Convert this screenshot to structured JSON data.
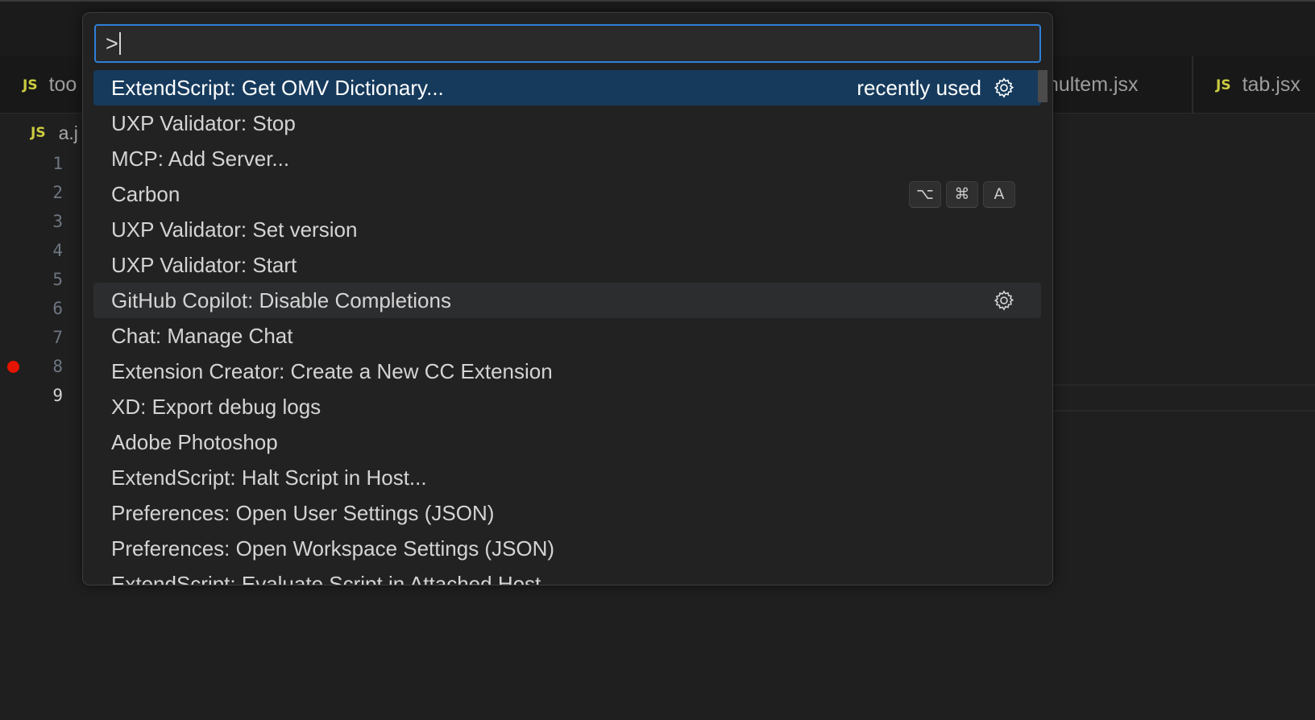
{
  "tabs": [
    {
      "icon": "JS",
      "label": "too"
    },
    {
      "icon": "",
      "label": "nultem.jsx"
    },
    {
      "icon": "JS",
      "label": "tab.jsx"
    }
  ],
  "breadcrumb": {
    "icon": "JS",
    "label": "a.j"
  },
  "gutter": [
    "1",
    "2",
    "3",
    "4",
    "5",
    "6",
    "7",
    "8",
    "9"
  ],
  "palette": {
    "input_value": ">",
    "items": [
      {
        "label": "ExtendScript: Get OMV Dictionary...",
        "detail": "recently used",
        "icon": "gear-icon",
        "keys": []
      },
      {
        "label": "UXP Validator: Stop",
        "detail": "",
        "icon": "",
        "keys": []
      },
      {
        "label": "MCP: Add Server...",
        "detail": "",
        "icon": "",
        "keys": []
      },
      {
        "label": "Carbon",
        "detail": "",
        "icon": "",
        "keys": [
          "⌥",
          "⌘",
          "A"
        ]
      },
      {
        "label": "UXP Validator: Set version",
        "detail": "",
        "icon": "",
        "keys": []
      },
      {
        "label": "UXP Validator: Start",
        "detail": "",
        "icon": "",
        "keys": []
      },
      {
        "label": "GitHub Copilot: Disable Completions",
        "detail": "",
        "icon": "gear-icon",
        "keys": []
      },
      {
        "label": "Chat: Manage Chat",
        "detail": "",
        "icon": "",
        "keys": []
      },
      {
        "label": "Extension Creator: Create a New CC Extension",
        "detail": "",
        "icon": "",
        "keys": []
      },
      {
        "label": "XD: Export debug logs",
        "detail": "",
        "icon": "",
        "keys": []
      },
      {
        "label": "Adobe Photoshop",
        "detail": "",
        "icon": "",
        "keys": []
      },
      {
        "label": "ExtendScript: Halt Script in Host...",
        "detail": "",
        "icon": "",
        "keys": []
      },
      {
        "label": "Preferences: Open User Settings (JSON)",
        "detail": "",
        "icon": "",
        "keys": []
      },
      {
        "label": "Preferences: Open Workspace Settings (JSON)",
        "detail": "",
        "icon": "",
        "keys": []
      },
      {
        "label": "ExtendScript: Evaluate Script in Attached Host",
        "detail": "",
        "icon": "",
        "keys": []
      }
    ]
  },
  "colors": {
    "selected_row": "#163a5c",
    "hover_row": "#2c2d2f",
    "input_border": "#2f7fd8",
    "breakpoint": "#e51400",
    "js_icon": "#cbcb41"
  }
}
